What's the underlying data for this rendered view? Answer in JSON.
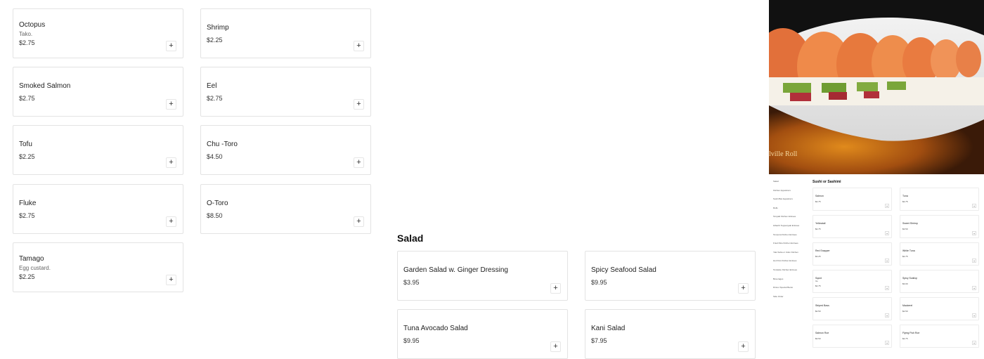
{
  "add_symbol": "+",
  "items": [
    {
      "name": "Octopus",
      "desc": "Tako.",
      "price": "$2.75"
    },
    {
      "name": "Shrimp",
      "price": "$2.25"
    },
    {
      "name": "Smoked Salmon",
      "price": "$2.75"
    },
    {
      "name": "Eel",
      "price": "$2.75"
    },
    {
      "name": "Tofu",
      "price": "$2.25"
    },
    {
      "name": "Chu -Toro",
      "price": "$4.50"
    },
    {
      "name": "Fluke",
      "price": "$2.75"
    },
    {
      "name": "O-Toro",
      "price": "$8.50"
    },
    {
      "name": "Tamago",
      "desc": "Egg custard.",
      "price": "$2.25"
    }
  ],
  "salad": {
    "title": "Salad",
    "items": [
      {
        "name": "Garden Salad w. Ginger Dressing",
        "price": "$3.95"
      },
      {
        "name": "Spicy Seafood Salad",
        "price": "$9.95"
      },
      {
        "name": "Tuna Avocado Salad",
        "price": "$9.95"
      },
      {
        "name": "Kani Salad",
        "price": "$7.95"
      }
    ]
  },
  "hero": {
    "caption": "lville Roll",
    "image": "sushi-roll-photo"
  },
  "mini": {
    "nav": [
      "Salad",
      "Kitchen Appetizers",
      "Sushi Bar Appetizers",
      "Rolls",
      "Teriyaki Kitchen Entrees",
      "Hibachi Teppanyaki Entrées",
      "Tempura Kitchen Entrees",
      "Fried Rice Kitchen Entrees",
      "Yaki Soba or Udon Kitchen",
      "Hot Pots Kitchen Entrees",
      "Tonkatsu Kitchen Entrees",
      "Beverages",
      "Dinner Special Bento",
      "Side Order"
    ],
    "title": "Sushi or Sashimi",
    "items": [
      {
        "name": "Salmon",
        "price": "$2.75"
      },
      {
        "name": "Tuna",
        "price": "$2.75"
      },
      {
        "name": "Yellowtail",
        "price": "$2.75"
      },
      {
        "name": "Sweet Shrimp",
        "price": "$3.50"
      },
      {
        "name": "Red Snapper",
        "price": "$3.25"
      },
      {
        "name": "White Tuna",
        "price": "$2.75"
      },
      {
        "name": "Squid",
        "desc": "Ika.",
        "price": "$2.75"
      },
      {
        "name": "Spicy Scallop",
        "price": "$3.00"
      },
      {
        "name": "Striped Bass",
        "price": "$2.50"
      },
      {
        "name": "Mackerel",
        "price": "$2.50"
      },
      {
        "name": "Salmon Roe",
        "price": "$3.50"
      },
      {
        "name": "Flying Fish Roe",
        "price": "$2.75"
      }
    ]
  }
}
